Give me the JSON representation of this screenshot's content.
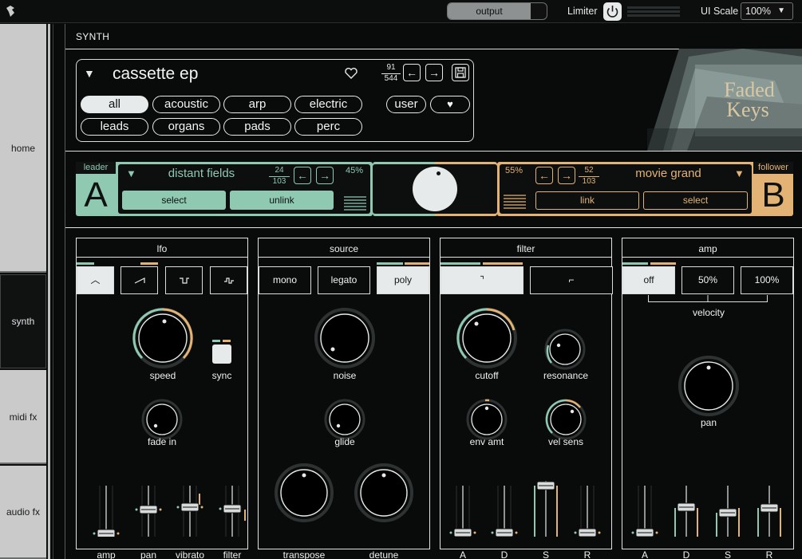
{
  "topbar": {
    "output_label": "output",
    "limiter_label": "Limiter",
    "ui_scale_label": "UI Scale",
    "ui_scale_value": "100%"
  },
  "sidebar": {
    "items": [
      {
        "label": "home"
      },
      {
        "label": "synth"
      },
      {
        "label": "midi fx"
      },
      {
        "label": "audio fx"
      }
    ]
  },
  "page_title": "SYNTH",
  "preset": {
    "name": "cassette ep",
    "index": "91",
    "total": "544",
    "categories": [
      "all",
      "acoustic",
      "arp",
      "electric",
      "leads",
      "organs",
      "pads",
      "perc"
    ],
    "selected_category": "all",
    "user_label": "user"
  },
  "art": {
    "line1": "Faded",
    "line2": "Keys"
  },
  "layer_a": {
    "tag": "leader",
    "letter": "A",
    "preset": "distant fields",
    "index": "24",
    "total": "103",
    "percent": "45%",
    "select_label": "select",
    "unlink_label": "unlink"
  },
  "layer_b": {
    "tag": "follower",
    "letter": "B",
    "preset": "movie grand",
    "index": "52",
    "total": "103",
    "percent": "55%",
    "link_label": "link",
    "select_label": "select"
  },
  "lfo": {
    "title": "lfo",
    "speed": "speed",
    "sync": "sync",
    "fade_in": "fade in",
    "sliders": [
      "amp",
      "pan",
      "vibrato",
      "filter"
    ]
  },
  "source": {
    "title": "source",
    "modes": [
      "mono",
      "legato",
      "poly"
    ],
    "noise": "noise",
    "glide": "glide",
    "transpose": "transpose",
    "detune": "detune"
  },
  "filter": {
    "title": "filter",
    "cutoff": "cutoff",
    "resonance": "resonance",
    "env_amt": "env amt",
    "vel_sens": "vel sens",
    "adsr": [
      "A",
      "D",
      "S",
      "R"
    ]
  },
  "amp": {
    "title": "amp",
    "velocity_options": [
      "off",
      "50%",
      "100%"
    ],
    "velocity_label": "velocity",
    "pan": "pan",
    "adsr": [
      "A",
      "D",
      "S",
      "R"
    ]
  },
  "colors": {
    "teal": "#8fc9b2",
    "orange": "#e3b275",
    "panel_bg": "#090b0b",
    "light": "#e6eaea"
  }
}
